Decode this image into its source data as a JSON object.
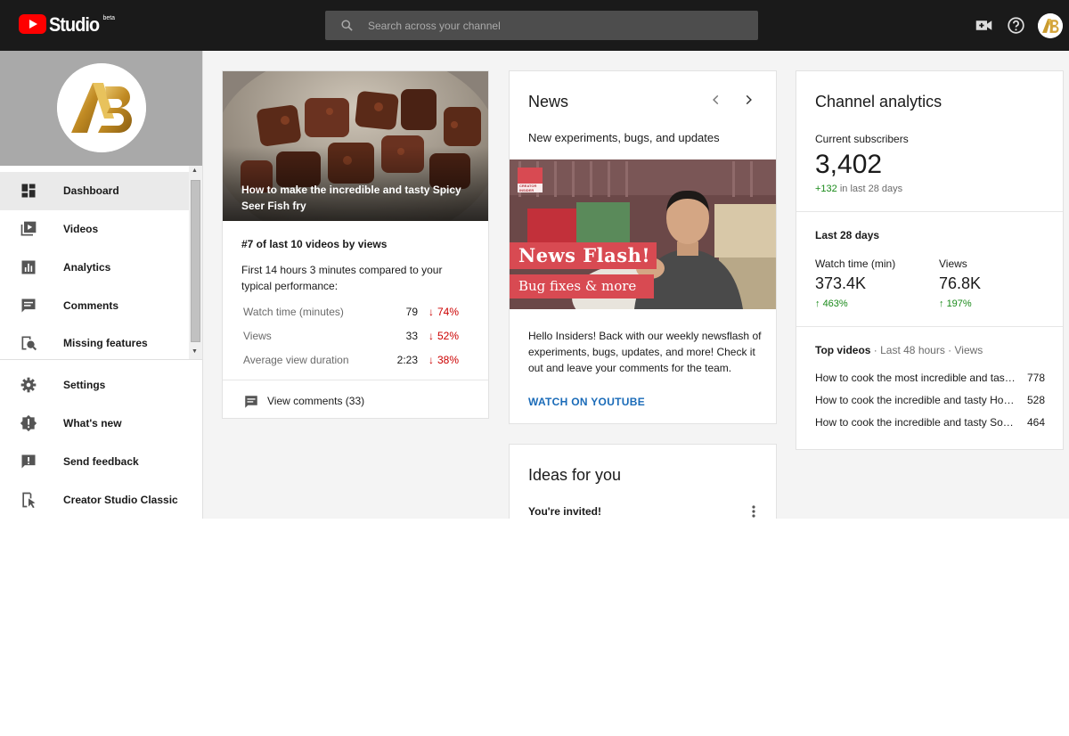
{
  "app": {
    "name": "Studio",
    "badge": "beta"
  },
  "search": {
    "placeholder": "Search across your channel"
  },
  "header": {
    "create_icon": "video-camera-icon",
    "help_icon": "help-circle-icon",
    "avatar_text": "AB"
  },
  "channel": {
    "avatar_text": "AB"
  },
  "sidebar": {
    "items": [
      {
        "label": "Dashboard",
        "icon": "dashboard-icon",
        "active": true
      },
      {
        "label": "Videos",
        "icon": "videos-icon"
      },
      {
        "label": "Analytics",
        "icon": "analytics-icon"
      },
      {
        "label": "Comments",
        "icon": "comments-icon"
      },
      {
        "label": "Missing features",
        "icon": "missing-features-icon"
      }
    ],
    "secondary": [
      {
        "label": "Settings",
        "icon": "gear-icon"
      },
      {
        "label": "What's new",
        "icon": "whats-new-icon"
      },
      {
        "label": "Send feedback",
        "icon": "feedback-icon"
      },
      {
        "label": "Creator Studio Classic",
        "icon": "classic-icon"
      }
    ]
  },
  "latest_video": {
    "title": "How to make the incredible and tasty Spicy Seer Fish fry",
    "rank": "#7 of last 10 videos by views",
    "comparison": "First 14 hours 3 minutes compared to your typical performance:",
    "metrics": [
      {
        "label": "Watch time (minutes)",
        "value": "79",
        "change": "74%"
      },
      {
        "label": "Views",
        "value": "33",
        "change": "52%"
      },
      {
        "label": "Average view duration",
        "value": "2:23",
        "change": "38%"
      }
    ],
    "comments_link": "View comments (33)"
  },
  "news": {
    "title": "News",
    "subtitle": "New experiments, bugs, and updates",
    "image_badge": "CREATOR INSIDER",
    "image_headline": "News Flash!",
    "image_subline": "Bug fixes & more",
    "body": "Hello Insiders! Back with our weekly newsflash of experiments, bugs, updates, and more! Check it out and leave your comments for the team.",
    "link": "WATCH ON YOUTUBE"
  },
  "ideas": {
    "title": "Ideas for you",
    "item": "You're invited!"
  },
  "analytics": {
    "title": "Channel analytics",
    "subscribers_label": "Current subscribers",
    "subscribers": "3,402",
    "subscribers_change": "+132",
    "subscribers_period": " in last 28 days",
    "period": "Last 28 days",
    "watch_label": "Watch time (min)",
    "watch_value": "373.4K",
    "watch_change": "463%",
    "views_label": "Views",
    "views_value": "76.8K",
    "views_change": "197%",
    "top_videos_label": "Top videos",
    "top_videos_meta": " · Last 48 hours · Views",
    "top_videos": [
      {
        "title": "How to cook the most incredible and tasty Spicy",
        "views": "778"
      },
      {
        "title": "How to cook the incredible and tasty Homemade",
        "views": "528"
      },
      {
        "title": "How to cook the incredible and tasty Soya Chunks",
        "views": "464"
      }
    ]
  },
  "colors": {
    "accent_red": "#ff0000",
    "topbar": "#1a1a1a",
    "down": "#cc0000",
    "up": "#1a8a1a",
    "link": "#1a6bb8"
  }
}
